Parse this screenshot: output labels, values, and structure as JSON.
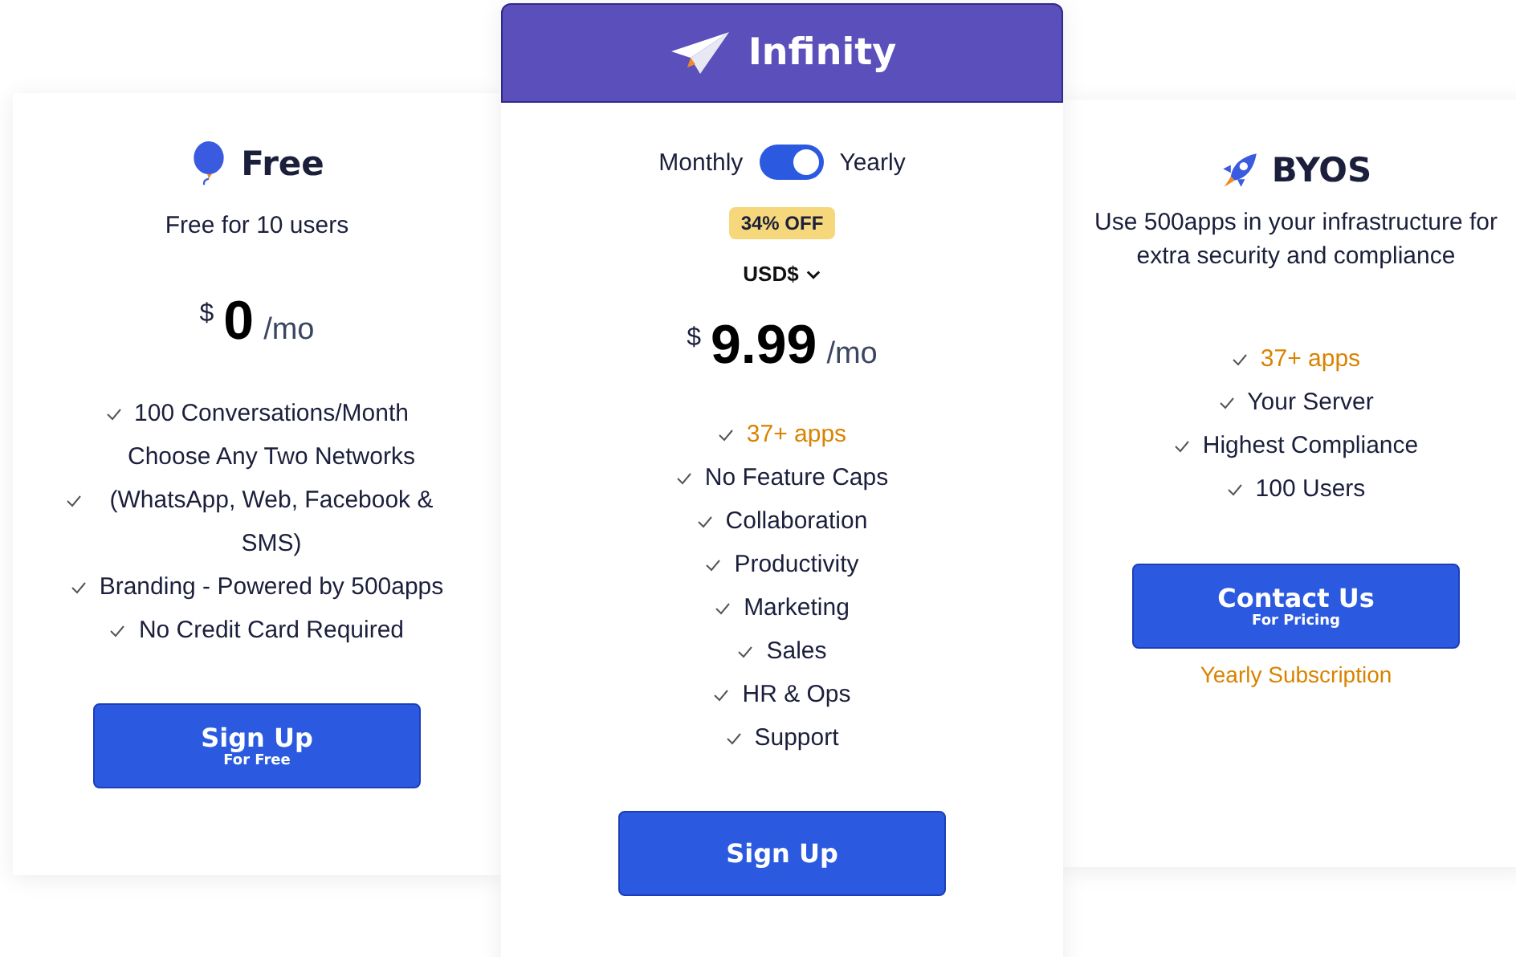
{
  "plans": [
    {
      "name": "Free",
      "featured": false,
      "subtitle": "Free for 10 users",
      "price": {
        "currency": "$",
        "amount": "0",
        "period": "/mo"
      },
      "features": [
        {
          "text": "100 Conversations/Month",
          "highlight": false
        },
        {
          "text": "Choose Any Two Networks (WhatsApp, Web, Facebook & SMS)",
          "highlight": false
        },
        {
          "text": "Branding - Powered by 500apps",
          "highlight": false
        },
        {
          "text": "No Credit Card Required",
          "highlight": false
        }
      ],
      "button": {
        "label": "Sign Up",
        "sublabel": "For Free"
      }
    },
    {
      "name": "Infinity",
      "featured": true,
      "billing": {
        "left": "Monthly",
        "right": "Yearly",
        "on": true
      },
      "badge": "34% OFF",
      "currency_select": "USD$",
      "price": {
        "currency": "$",
        "amount": "9.99",
        "period": "/mo"
      },
      "features": [
        {
          "text": "37+ apps",
          "highlight": true
        },
        {
          "text": "No Feature Caps",
          "highlight": false
        },
        {
          "text": "Collaboration",
          "highlight": false
        },
        {
          "text": "Productivity",
          "highlight": false
        },
        {
          "text": "Marketing",
          "highlight": false
        },
        {
          "text": "Sales",
          "highlight": false
        },
        {
          "text": "HR & Ops",
          "highlight": false
        },
        {
          "text": "Support",
          "highlight": false
        }
      ],
      "button": {
        "label": "Sign Up"
      }
    },
    {
      "name": "BYOS",
      "featured": false,
      "subtitle": "Use 500apps in your infrastructure for extra security and compliance",
      "features": [
        {
          "text": "37+ apps",
          "highlight": true
        },
        {
          "text": "Your Server",
          "highlight": false
        },
        {
          "text": "Highest Compliance",
          "highlight": false
        },
        {
          "text": "100 Users",
          "highlight": false
        }
      ],
      "button": {
        "label": "Contact Us",
        "sublabel": "For Pricing"
      },
      "note": "Yearly Subscription"
    }
  ]
}
